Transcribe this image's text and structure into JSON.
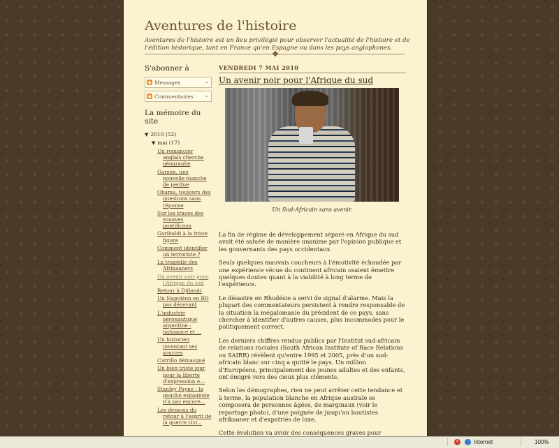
{
  "blog": {
    "title": "Aventures de l'histoire",
    "description": "Aventures de l'histoire est un lieu privilégié pour observer l'actualité de l'histoire et de l'édition historique, tant en France qu'en Espagne ou dans les pays anglophones."
  },
  "sidebar": {
    "subscribe_heading": "S'abonner à",
    "subscribe": [
      {
        "label": "Messages"
      },
      {
        "label": "Commentaires"
      }
    ],
    "archive_heading": "La mémoire du site",
    "year": "2010 (52)",
    "month": "mai (17)",
    "posts": [
      "Un romancier anglais cherche géographe",
      "Garzon, une nouvelle manche de perdue",
      "Obama, toujours des questions sans réponse",
      "Sur les traces des zouaves pontificaux",
      "Garibaldi à la triste figure",
      "Comment identifier un terroriste ?",
      "La tragédie des Afrikaaners",
      "Un avenir noir pour l'Afrique du sud",
      "Retour à Djibouti",
      "Un Napoléon en BD pas décevant",
      "L'industrie aéronautique argentine : naissance et ...",
      "Un historien inventant ses sources",
      "Carrillo démasqué",
      "Un bien triste jour pour la liberté d'expression e...",
      "Stanley Payne : la gauche espagnole n'a pas encore...",
      "Les dessous du retour à l'esprit de la guerre civi..."
    ],
    "current_post_index": 7
  },
  "post": {
    "date": "VENDREDI 7 MAI 2010",
    "title": "Un avenir noir pour l'Afrique du sud",
    "caption": "Un Sud-Africain sans avenir.",
    "paragraphs": [
      "La fin de régime de développement séparé en Afrique du sud avait été saluée de manière unanime par l'opinion publique et les gouvernants des pays occidentaux.",
      "Seuls quelques mauvais coucheurs à l'émotivité échaudée par une expérience vécue du continent africain osaient émettre quelques doutes quant à la viabilité à long terme de l'expérience.",
      "Le désastre en Rhodésie a servi de signal d'alarme. Mais la plupart des commentateurs persistent à rendre responsable de la situation la mégalomanie du président de ce pays, sans chercher à identifier d'autres causes, plus incommodes pour le politiquement correct.",
      "Les derniers chiffres rendus publics par l'Institut sud-africain de relations raciales (South African Institute of Race Relations ou SAIRR) révèlent qu'entre 1995 et 2005, près d'un sud-africain blanc sur cinq a quitté le pays. Un million d'Européens, principalement des jeunes adultes et des enfants, ont émigré vers des cieux plus cléments.",
      "Selon les démographes, rien ne peut arrêter cette tendance et à terme, la population blanche en Afrique australe se composera de personnes âgées, de marginaux (voir le reportage photo), d'une poignée de jusqu'au boutistes afrikaaner et d'expatriés de luxe.",
      "Cette évolution va avoir des conséquences graves pour l'économie. les Blancs constituent la principale ressource de recettes fiscales du pays et le réservoir de spécialistes indispensables au fonctionnement d'une société développée."
    ]
  },
  "statusbar": {
    "zone": "Internet",
    "zoom": "100%"
  }
}
